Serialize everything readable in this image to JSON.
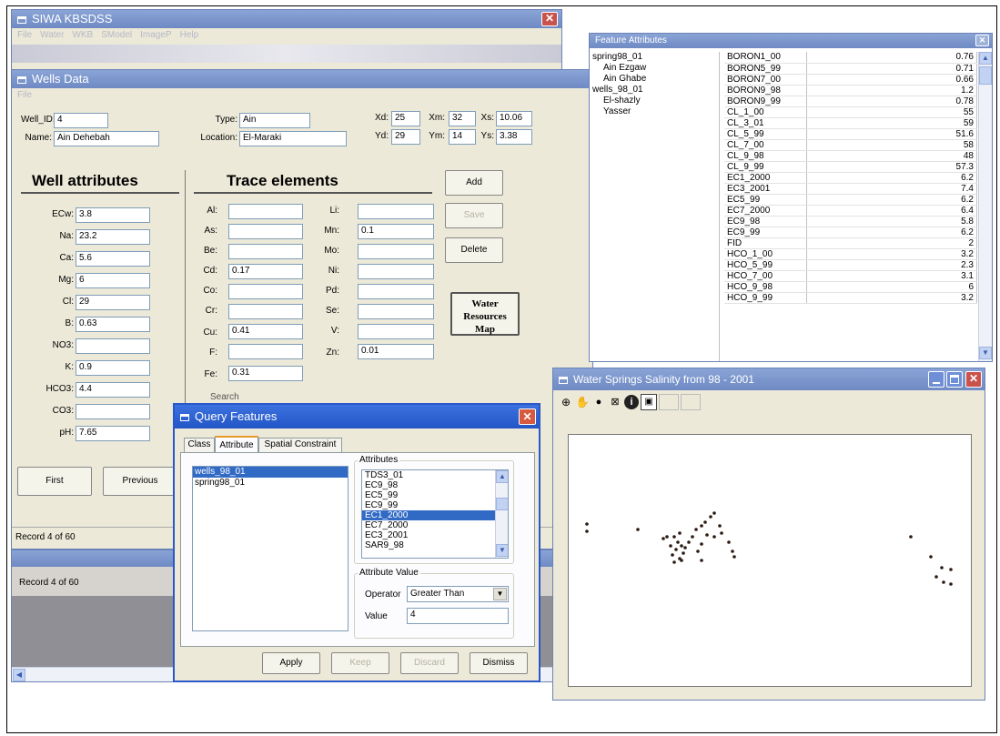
{
  "main_window": {
    "title": "SIWA KBSDSS",
    "menu": [
      "File",
      "Water",
      "WKB",
      "SModel",
      "ImageP",
      "Help"
    ]
  },
  "wells_window": {
    "title": "Wells Data",
    "menu": [
      "File"
    ],
    "well_id_label": "Well_ID:",
    "well_id": "4",
    "name_label": "Name:",
    "name": "Ain Dehebah",
    "type_label": "Type:",
    "type": "Ain",
    "location_label": "Location:",
    "location": "El-Maraki",
    "coords": [
      {
        "label": "Xd:",
        "value": "25"
      },
      {
        "label": "Xm:",
        "value": "32"
      },
      {
        "label": "Xs:",
        "value": "10.06"
      },
      {
        "label": "Yd:",
        "value": "29"
      },
      {
        "label": "Ym:",
        "value": "14"
      },
      {
        "label": "Ys:",
        "value": "3.38"
      }
    ],
    "well_attributes_title": "Well attributes",
    "well_attributes": [
      {
        "label": "ECw:",
        "value": "3.8"
      },
      {
        "label": "Na:",
        "value": "23.2"
      },
      {
        "label": "Ca:",
        "value": "5.6"
      },
      {
        "label": "Mg:",
        "value": "6"
      },
      {
        "label": "Cl:",
        "value": "29"
      },
      {
        "label": "B:",
        "value": "0.63"
      },
      {
        "label": "NO3:",
        "value": ""
      },
      {
        "label": "K:",
        "value": "0.9"
      },
      {
        "label": "HCO3:",
        "value": "4.4"
      },
      {
        "label": "CO3:",
        "value": ""
      },
      {
        "label": "pH:",
        "value": "7.65"
      }
    ],
    "trace_title": "Trace elements",
    "trace_col1": [
      {
        "label": "Al:",
        "value": ""
      },
      {
        "label": "As:",
        "value": ""
      },
      {
        "label": "Be:",
        "value": ""
      },
      {
        "label": "Cd:",
        "value": "0.17"
      },
      {
        "label": "Co:",
        "value": ""
      },
      {
        "label": "Cr:",
        "value": ""
      },
      {
        "label": "Cu:",
        "value": "0.41"
      },
      {
        "label": "F:",
        "value": ""
      },
      {
        "label": "Fe:",
        "value": "0.31"
      }
    ],
    "trace_col2": [
      {
        "label": "Li:",
        "value": ""
      },
      {
        "label": "Mn:",
        "value": "0.1"
      },
      {
        "label": "Mo:",
        "value": ""
      },
      {
        "label": "Ni:",
        "value": ""
      },
      {
        "label": "Pd:",
        "value": ""
      },
      {
        "label": "Se:",
        "value": ""
      },
      {
        "label": "V:",
        "value": ""
      },
      {
        "label": "Zn:",
        "value": "0.01"
      }
    ],
    "buttons": {
      "add": "Add",
      "save": "Save",
      "delete": "Delete",
      "map": "Water Resources Map",
      "first": "First",
      "previous": "Previous"
    },
    "search_label": "Search",
    "record": "Record 4 of 60"
  },
  "lower_window": {
    "record": "Record 4 of 60"
  },
  "feature_attributes": {
    "title": "Feature Attributes",
    "tree": [
      {
        "label": "spring98_01",
        "level": 0
      },
      {
        "label": "Ain Ezgaw",
        "level": 1
      },
      {
        "label": "Ain Ghabe",
        "level": 1
      },
      {
        "label": "wells_98_01",
        "level": 0
      },
      {
        "label": "El-shazly",
        "level": 1
      },
      {
        "label": "Yasser",
        "level": 1
      }
    ],
    "rows": [
      [
        "BORON1_00",
        "0.76"
      ],
      [
        "BORON5_99",
        "0.71"
      ],
      [
        "BORON7_00",
        "0.66"
      ],
      [
        "BORON9_98",
        "1.2"
      ],
      [
        "BORON9_99",
        "0.78"
      ],
      [
        "CL_1_00",
        "55"
      ],
      [
        "CL_3_01",
        "59"
      ],
      [
        "CL_5_99",
        "51.6"
      ],
      [
        "CL_7_00",
        "58"
      ],
      [
        "CL_9_98",
        "48"
      ],
      [
        "CL_9_99",
        "57.3"
      ],
      [
        "EC1_2000",
        "6.2"
      ],
      [
        "EC3_2001",
        "7.4"
      ],
      [
        "EC5_99",
        "6.2"
      ],
      [
        "EC7_2000",
        "6.4"
      ],
      [
        "EC9_98",
        "5.8"
      ],
      [
        "EC9_99",
        "6.2"
      ],
      [
        "FID",
        "2"
      ],
      [
        "HCO_1_00",
        "3.2"
      ],
      [
        "HCO_5_99",
        "2.3"
      ],
      [
        "HCO_7_00",
        "3.1"
      ],
      [
        "HCO_9_98",
        "6"
      ],
      [
        "HCO_9_99",
        "3.2"
      ]
    ]
  },
  "query_features": {
    "title": "Query Features",
    "tabs": [
      "Class",
      "Attribute",
      "Spatial Constraint"
    ],
    "active_tab": "Attribute",
    "classes": [
      "wells_98_01",
      "spring98_01"
    ],
    "selected_class": "wells_98_01",
    "attributes_label": "Attributes",
    "attributes": [
      "TDS3_01",
      "EC9_98",
      "EC5_99",
      "EC9_99",
      "EC1_2000",
      "EC7_2000",
      "EC3_2001",
      "SAR9_98"
    ],
    "selected_attribute": "EC1_2000",
    "attribute_value_label": "Attribute Value",
    "operator_label": "Operator",
    "operator": "Greater Than",
    "value_label": "Value",
    "value": "4",
    "buttons": {
      "apply": "Apply",
      "keep": "Keep",
      "discard": "Discard",
      "dismiss": "Dismiss"
    }
  },
  "salinity_window": {
    "title": "Water Springs Salinity from 98 - 2001",
    "tools": [
      "zoom-in-icon",
      "pan-icon",
      "globe-icon",
      "measure-icon",
      "info-icon",
      "select-icon"
    ]
  }
}
